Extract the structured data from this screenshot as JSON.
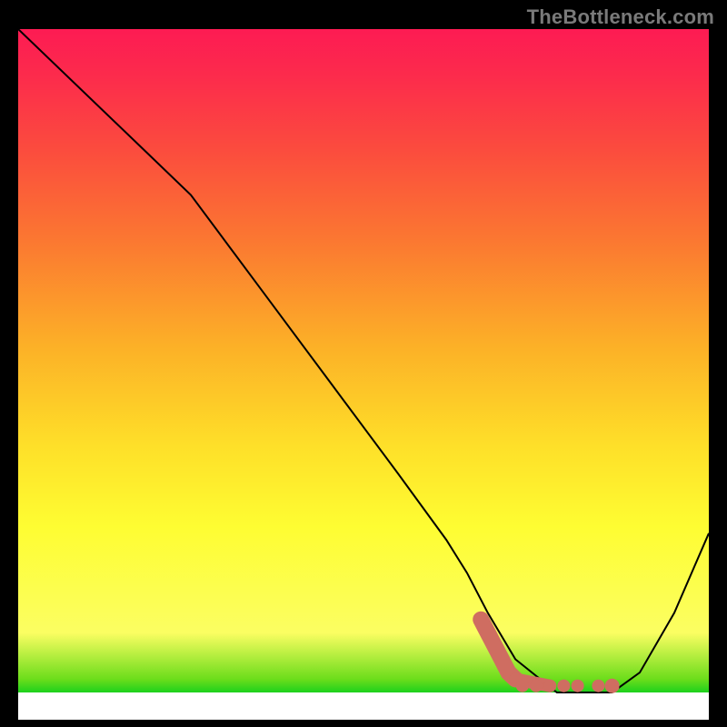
{
  "watermark": "TheBottleneck.com",
  "colors": {
    "curve_stroke": "#000000",
    "band_fill": "#cf6d61",
    "frame_bg": "#000000",
    "plot_bg": "#ffffff"
  },
  "chart_data": {
    "type": "line",
    "title": "",
    "xlabel": "",
    "ylabel": "",
    "xlim": [
      0,
      100
    ],
    "ylim": [
      0,
      100
    ],
    "grid": false,
    "series": [
      {
        "name": "bottleneck-curve",
        "x": [
          0,
          18,
          25,
          35,
          45,
          55,
          62,
          65,
          68,
          72,
          78,
          82,
          86,
          90,
          95,
          100
        ],
        "values": [
          100,
          82,
          75,
          61,
          47,
          33,
          23,
          18,
          12,
          5,
          0,
          0,
          0,
          3,
          12,
          24
        ]
      }
    ],
    "scatter_band": {
      "name": "optimal-range",
      "points": [
        {
          "x": 67,
          "y": 11
        },
        {
          "x": 68,
          "y": 9
        },
        {
          "x": 69,
          "y": 7
        },
        {
          "x": 70,
          "y": 5
        },
        {
          "x": 71,
          "y": 3
        },
        {
          "x": 72,
          "y": 2
        },
        {
          "x": 73,
          "y": 1
        },
        {
          "x": 75,
          "y": 1
        },
        {
          "x": 77,
          "y": 1
        },
        {
          "x": 79,
          "y": 1
        },
        {
          "x": 81,
          "y": 1
        },
        {
          "x": 84,
          "y": 1
        },
        {
          "x": 86,
          "y": 1
        }
      ]
    }
  }
}
